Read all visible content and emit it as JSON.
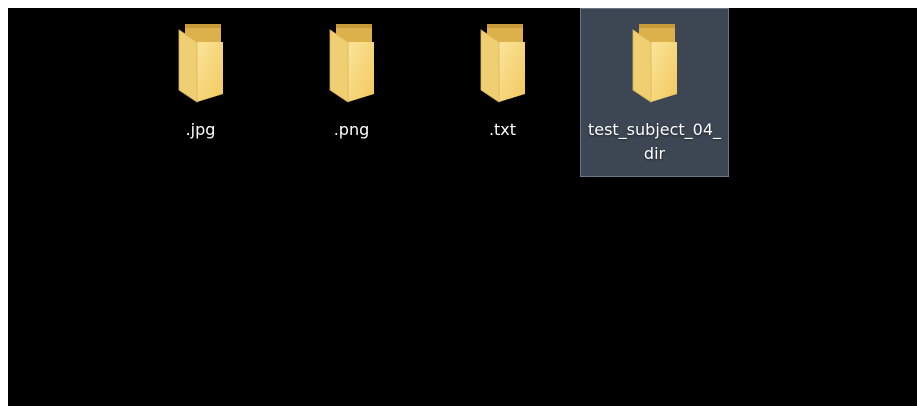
{
  "desktop": {
    "items": [
      {
        "label": ".jpg",
        "type": "folder",
        "icon": "folder-icon",
        "selected": false
      },
      {
        "label": ".png",
        "type": "folder",
        "icon": "folder-icon",
        "selected": false
      },
      {
        "label": ".txt",
        "type": "folder",
        "icon": "folder-icon",
        "selected": false
      },
      {
        "label": "test_subject_04_dir",
        "type": "folder",
        "icon": "folder-icon",
        "selected": true
      }
    ]
  },
  "colors": {
    "background": "#000000",
    "selection_fill": "#3d4754",
    "selection_border": "#68788a",
    "folder_front": "#f5d97a",
    "folder_back": "#e4b94a"
  }
}
